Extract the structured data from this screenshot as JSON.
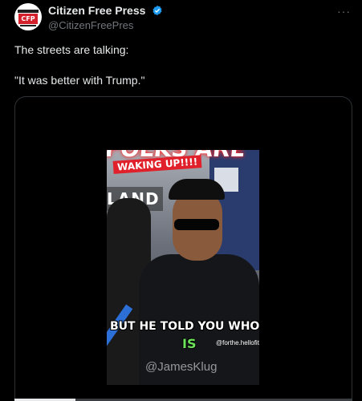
{
  "author": {
    "display_name": "Citizen Free Press",
    "handle": "@CitizenFreePres",
    "avatar_text": "CFP",
    "verified_color": "#1d9bf0"
  },
  "menu": {
    "more_label": "···"
  },
  "tweet": {
    "line1": "The streets are talking:",
    "line2": "\"It was better with Trump.\""
  },
  "video": {
    "caption_top": "FOLKS ARE",
    "caption_banner": "WAKING UP!!!!",
    "sign_text": "LAND",
    "subtitle_1": "BUT HE TOLD YOU WHO HE",
    "subtitle_2": "IS",
    "tiktok_tag": "@forthe.hellofit",
    "watermark": "@JamesKlug",
    "progress_fraction": 0.18
  },
  "colors": {
    "background": "#000000",
    "text_primary": "#e7e9ea",
    "text_secondary": "#71767b",
    "border": "#2f3336",
    "caption_glow": "#ff2a2a",
    "subtitle_green": "#6de35a"
  }
}
